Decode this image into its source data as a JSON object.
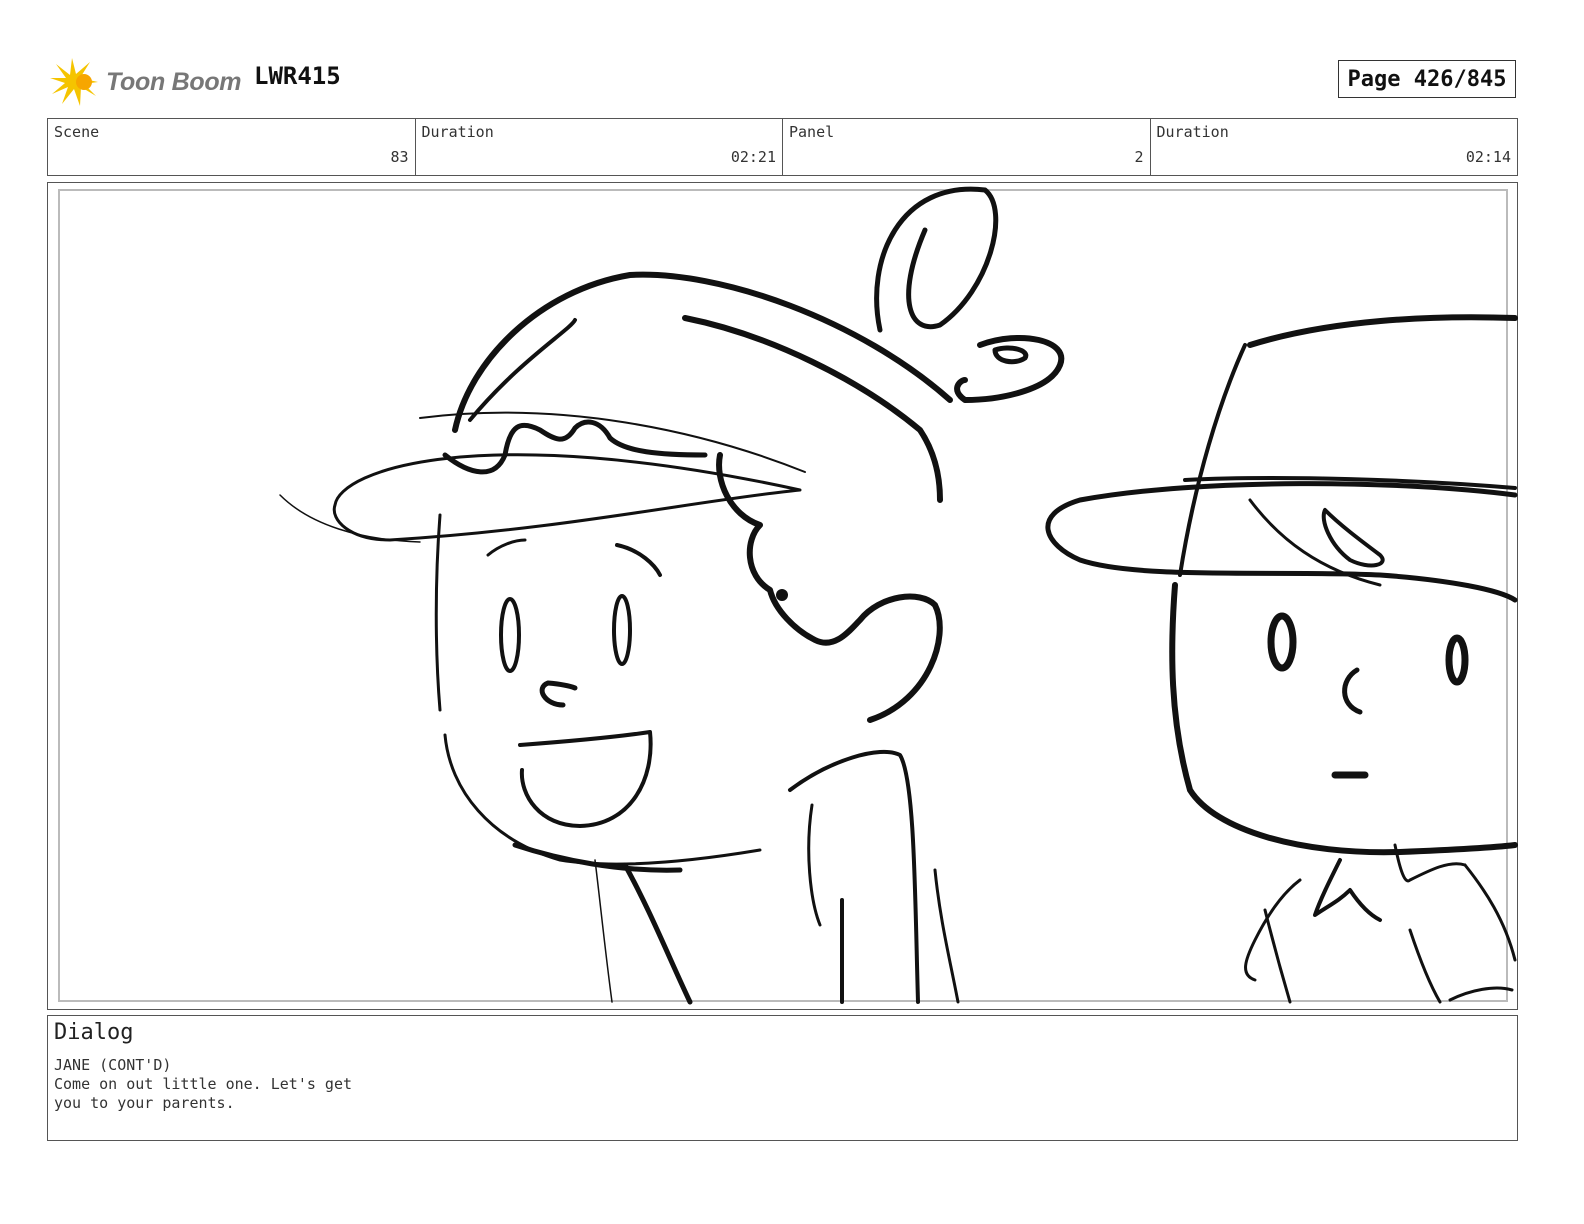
{
  "header": {
    "logo_text": "Toon Boom",
    "project_code": "LWR415",
    "page_label": "Page 426/845"
  },
  "info": {
    "cells": [
      {
        "label": "Scene",
        "value": "83"
      },
      {
        "label": "Duration",
        "value": "02:21"
      },
      {
        "label": "Panel",
        "value": "2"
      },
      {
        "label": "Duration",
        "value": "02:14"
      }
    ]
  },
  "dialog": {
    "title": "Dialog",
    "speaker": "JANE (CONT'D)",
    "lines": [
      "Come on out little one. Let's get",
      "you to your parents."
    ]
  },
  "colors": {
    "logo_accent": "#f5c400",
    "ink": "#111111"
  }
}
